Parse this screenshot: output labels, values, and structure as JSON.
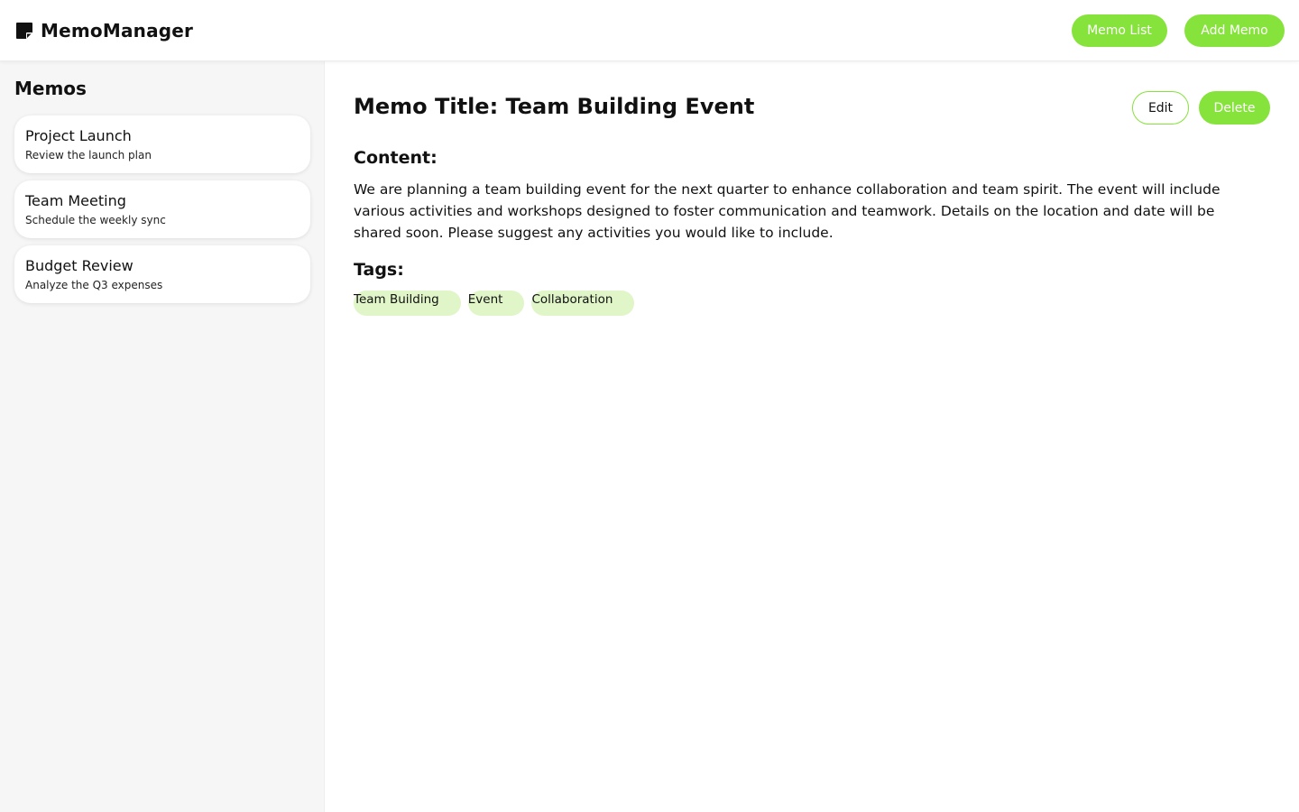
{
  "app": {
    "name": "MemoManager",
    "icon": "sticky-note-icon",
    "accent": "#86e33b"
  },
  "nav": {
    "memo_list_label": "Memo List",
    "add_memo_label": "Add Memo"
  },
  "sidebar": {
    "title": "Memos",
    "memos": [
      {
        "title": "Project Launch",
        "subtitle": "Review the launch plan"
      },
      {
        "title": "Team Meeting",
        "subtitle": "Schedule the weekly sync"
      },
      {
        "title": "Budget Review",
        "subtitle": "Analyze the Q3 expenses"
      }
    ]
  },
  "memo": {
    "heading": "Memo Title: Team Building Event",
    "edit_label": "Edit",
    "delete_label": "Delete",
    "content_label": "Content:",
    "content": "We are planning a team building event for the next quarter to enhance collaboration and team spirit. The event will include various activities and workshops designed to foster communication and teamwork. Details on the location and date will be shared soon. Please suggest any activities you would like to include.",
    "tags_label": "Tags:",
    "tags": [
      "Team Building",
      "Event",
      "Collaboration"
    ]
  }
}
